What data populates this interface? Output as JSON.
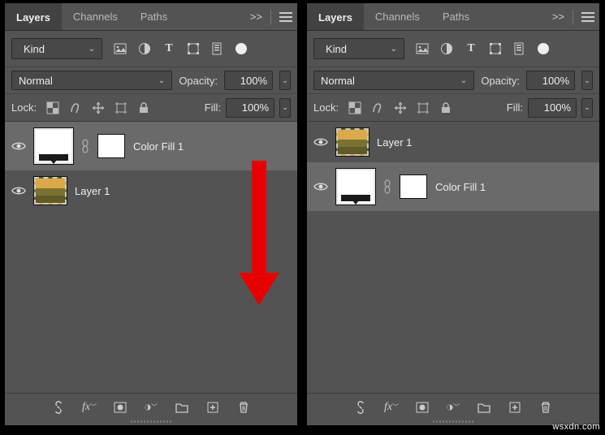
{
  "tabs": {
    "layers": "Layers",
    "channels": "Channels",
    "paths": "Paths",
    "expand": ">>"
  },
  "filter": {
    "kind_label": "Kind"
  },
  "blend": {
    "mode": "Normal",
    "opacity_label": "Opacity:",
    "opacity_value": "100%"
  },
  "lock": {
    "label": "Lock:",
    "fill_label": "Fill:",
    "fill_value": "100%"
  },
  "left_panel": {
    "layers": [
      {
        "name": "Color Fill 1",
        "type": "fill",
        "selected": true
      },
      {
        "name": "Layer 1",
        "type": "photo",
        "selected": false
      }
    ]
  },
  "right_panel": {
    "layers": [
      {
        "name": "Layer 1",
        "type": "photo",
        "selected": false
      },
      {
        "name": "Color Fill 1",
        "type": "fill",
        "selected": true
      }
    ]
  },
  "watermark": "wsxdn.com"
}
